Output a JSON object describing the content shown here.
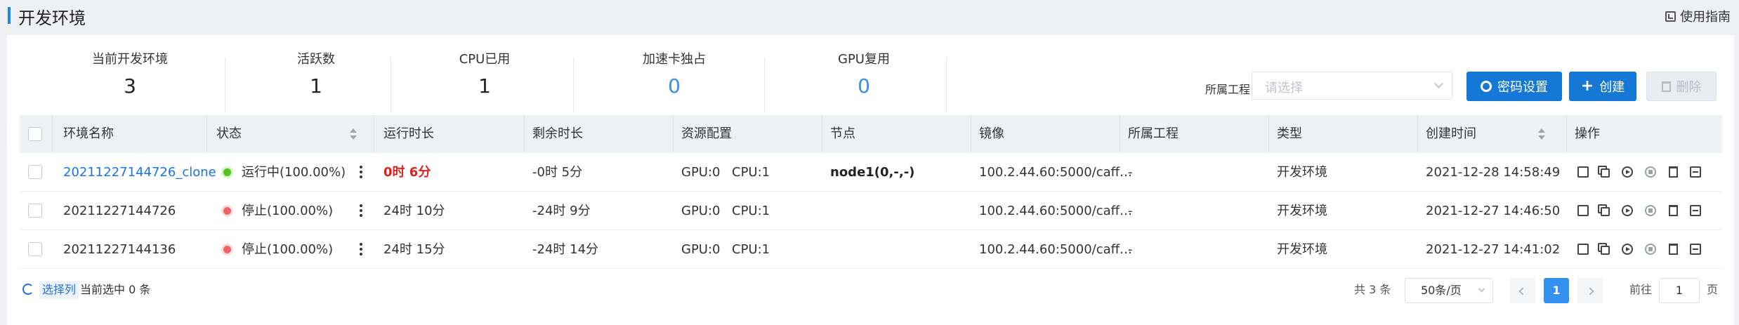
{
  "header": {
    "title": "开发环境",
    "guide_label": "使用指南"
  },
  "stats": [
    {
      "label": "当前开发环境",
      "value": "3"
    },
    {
      "label": "活跃数",
      "value": "1"
    },
    {
      "label": "CPU已用",
      "value": "1"
    },
    {
      "label": "加速卡独占",
      "value": "0"
    },
    {
      "label": "GPU复用",
      "value": "0"
    }
  ],
  "toolbar": {
    "project_label": "所属工程",
    "project_placeholder": "请选择",
    "secret_button": "密码设置",
    "create_button": "创建",
    "delete_button": "删除"
  },
  "columns": [
    "环境名称",
    "状态",
    "运行时长",
    "剩余时长",
    "资源配置",
    "节点",
    "镜像",
    "所属工程",
    "类型",
    "创建时间",
    "操作"
  ],
  "rows": [
    {
      "name": "20211227144726_clone",
      "status": "运行中(100.00%)",
      "status_color": "#52c41a",
      "run_time": "0时 6分",
      "remain_time": "-0时 5分",
      "gpu": "GPU:0",
      "cpu": "CPU:1",
      "node": "node1(0,-,-)",
      "image": "100.2.44.60:5000/caff…",
      "project": "-",
      "type": "开发环境",
      "created": "2021-12-28 14:58:49"
    },
    {
      "name": "20211227144726",
      "status": "停止(100.00%)",
      "status_color": "#f26363",
      "run_time": "24时 10分",
      "remain_time": "-24时 9分",
      "gpu": "GPU:0",
      "cpu": "CPU:1",
      "node": "",
      "image": "100.2.44.60:5000/caff…",
      "project": "-",
      "type": "开发环境",
      "created": "2021-12-27 14:46:50"
    },
    {
      "name": "20211227144136",
      "status": "停止(100.00%)",
      "status_color": "#f26363",
      "run_time": "24时 15分",
      "remain_time": "-24时 14分",
      "gpu": "GPU:0",
      "cpu": "CPU:1",
      "node": "",
      "image": "100.2.44.60:5000/caff…",
      "project": "-",
      "type": "开发环境",
      "created": "2021-12-27 14:41:02"
    }
  ],
  "footer": {
    "select_columns": "选择列",
    "selected_text": "当前选中 0 条",
    "total": "共 3 条",
    "page_size": "50条/页",
    "current_page": "1",
    "goto_label": "前往",
    "goto_value": "1",
    "goto_suffix": "页"
  }
}
